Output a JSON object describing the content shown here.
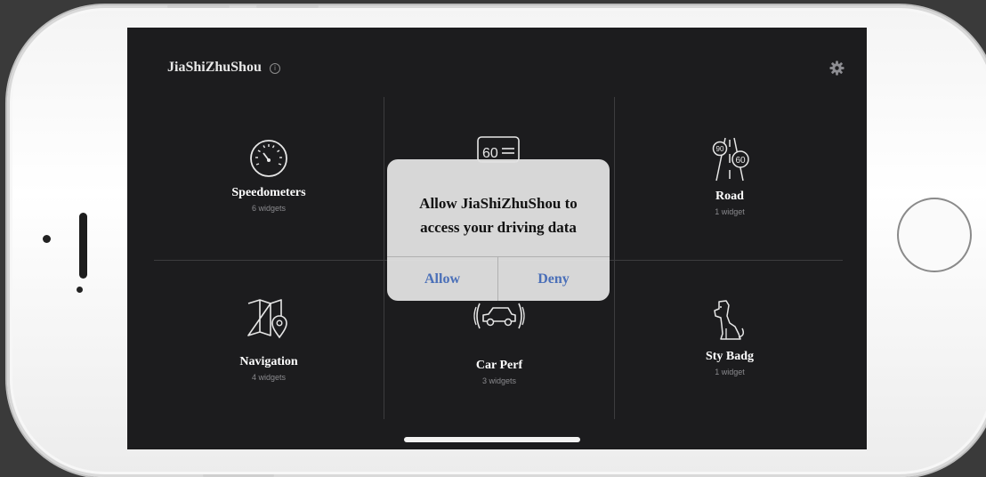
{
  "app": {
    "title": "JiaShiZhuShou",
    "info_glyph": "i"
  },
  "tiles": [
    {
      "name": "Speedometers",
      "count": "6 widgets",
      "icon": "speedometer-icon"
    },
    {
      "name": "Road",
      "count": "1 widget",
      "icon": "road-signs-icon"
    },
    {
      "name": "Navigation",
      "count": "4 widgets",
      "icon": "map-pin-icon"
    },
    {
      "name": "Car Perf",
      "count": "3 widgets",
      "icon": "car-performance-icon"
    },
    {
      "name": "Sty Badg",
      "count": "1 widget",
      "icon": "dog-icon"
    }
  ],
  "hidden_tile_icon": {
    "sign_text": "60",
    "icon": "speed-sign-icon"
  },
  "road_icon_text": {
    "left": "90",
    "right": "60"
  },
  "alert": {
    "line1": "Allow JiaShiZhuShou to",
    "line2": "access your driving data",
    "allow_label": "Allow",
    "deny_label": "Deny"
  },
  "colors": {
    "screen_bg": "#1c1c1e",
    "alert_bg": "#e1e1e1",
    "alert_button_text": "#4a6fb8",
    "divider": "#3c3c3e"
  }
}
